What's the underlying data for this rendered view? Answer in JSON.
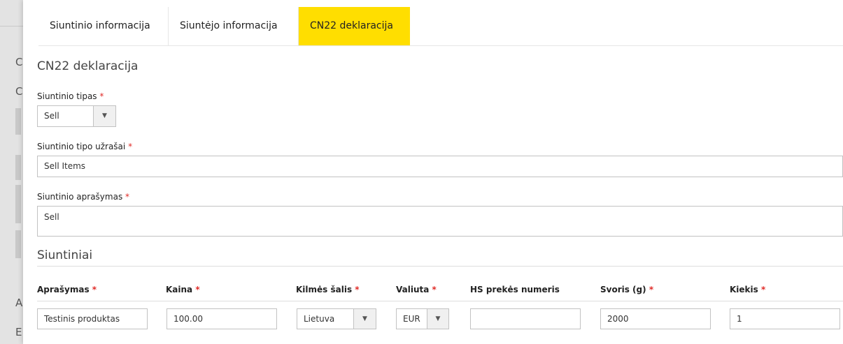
{
  "background": {
    "letters": [
      "C",
      "C",
      "A",
      "E"
    ]
  },
  "tabs": [
    {
      "label": "Siuntinio informacija"
    },
    {
      "label": "Siuntėjo informacija"
    },
    {
      "label": "CN22 deklaracija"
    }
  ],
  "form": {
    "section_title": "CN22 deklaracija",
    "type_label": "Siuntinio tipas",
    "type_value": "Sell",
    "notes_label": "Siuntinio tipo užrašai",
    "notes_value": "Sell Items",
    "desc_label": "Siuntinio aprašymas",
    "desc_value": "Sell",
    "required_mark": "*"
  },
  "parcels": {
    "title": "Siuntiniai",
    "columns": [
      "Aprašymas",
      "Kaina",
      "Kilmės šalis",
      "Valiuta",
      "HS prekės numeris",
      "Svoris (g)",
      "Kiekis"
    ],
    "required": [
      true,
      true,
      true,
      true,
      false,
      true,
      true
    ],
    "row": {
      "description": "Testinis produktas",
      "price": "100.00",
      "country": "Lietuva",
      "currency": "EUR",
      "hs_number": "",
      "weight": "2000",
      "quantity": "1"
    }
  },
  "icons": {
    "dropdown_arrow": "▼"
  },
  "colors": {
    "active_tab": "#ffde00",
    "required": "#e02b27"
  }
}
